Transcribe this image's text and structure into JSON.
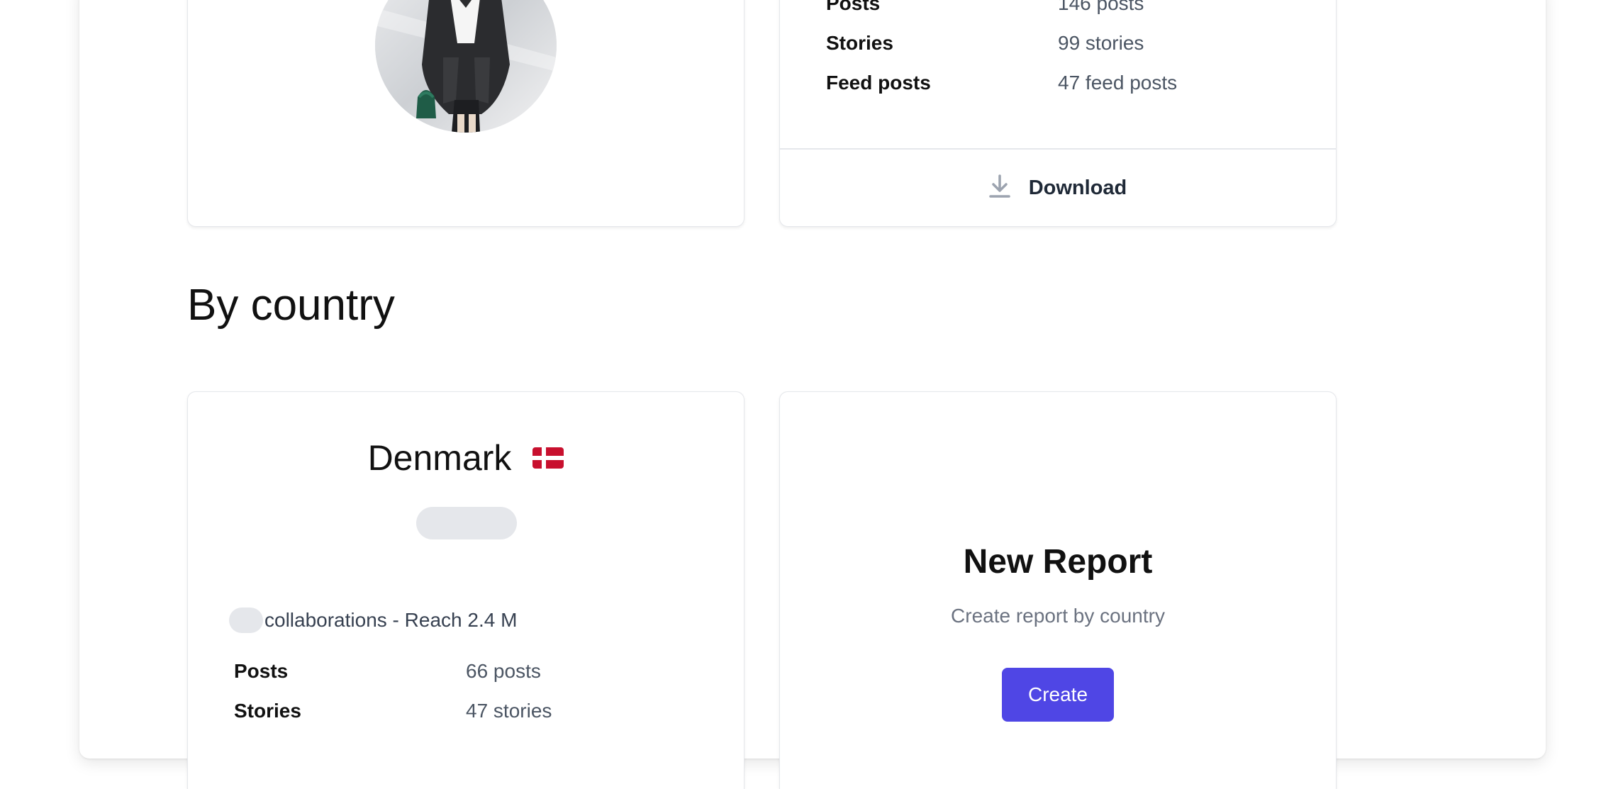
{
  "profile_card": {
    "avatar_alt": "profile photo"
  },
  "stats_card": {
    "rows": [
      {
        "label": "Posts",
        "value": "146 posts"
      },
      {
        "label": "Stories",
        "value": "99 stories"
      },
      {
        "label": "Feed posts",
        "value": "47 feed posts"
      }
    ],
    "download_label": "Download",
    "download_icon": "download-icon"
  },
  "section": {
    "title": "By country"
  },
  "country_card": {
    "country": "Denmark",
    "flag_icon": "denmark-flag-icon",
    "collab_text": "collaborations - Reach 2.4 M",
    "rows": [
      {
        "label": "Posts",
        "value": "66 posts"
      },
      {
        "label": "Stories",
        "value": "47 stories"
      }
    ]
  },
  "new_report_card": {
    "title": "New Report",
    "subtitle": "Create report by country",
    "button_label": "Create"
  },
  "colors": {
    "accent": "#4f46e5",
    "flag_red": "#c8102e",
    "muted_text": "#6b7280",
    "skeleton": "#e5e7eb"
  }
}
